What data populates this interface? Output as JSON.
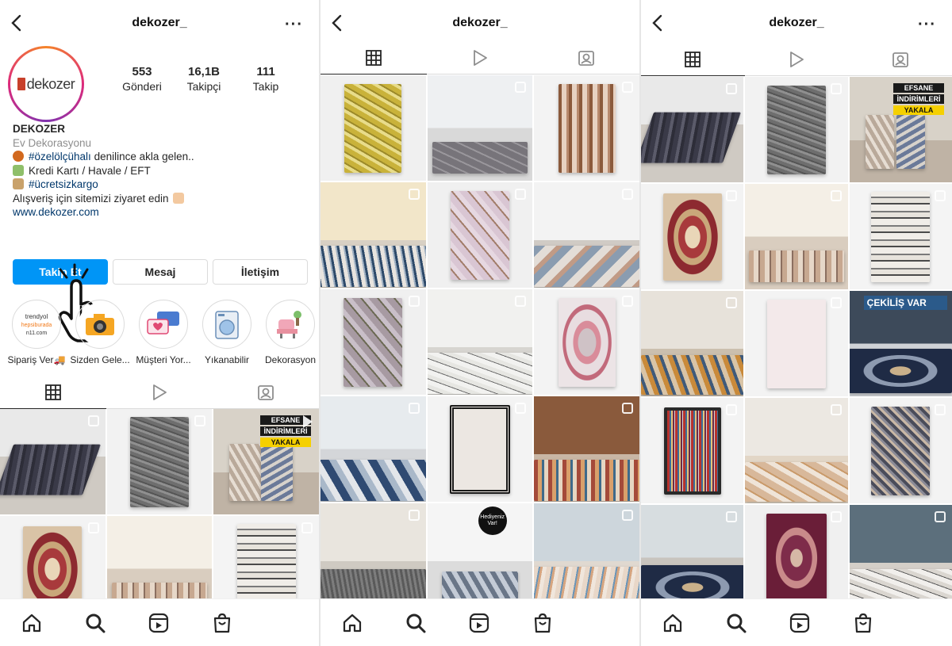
{
  "profile": {
    "username": "dekozer_",
    "logo_text": "dekozer",
    "posts_count": "553",
    "posts_label": "Gönderi",
    "followers_count": "16,1B",
    "followers_label": "Takipçi",
    "following_count": "111",
    "following_label": "Takip",
    "name": "DEKOZER",
    "category": "Ev Dekorasyonu",
    "bio_line1_tag": "#özelölçühalı",
    "bio_line1_text": " denilince akla gelen..",
    "bio_line2": "Kredi Kartı / Havale / EFT",
    "bio_line3_tag": "#ücretsizkargo",
    "bio_line4": "Alışveriş için sitemizi ziyaret edin",
    "website": "www.dekozer.com"
  },
  "buttons": {
    "follow": "Takip Et",
    "message": "Mesaj",
    "contact": "İletişim"
  },
  "highlights": [
    {
      "label": "Sipariş Ver🚚",
      "logo_a": "trendyol",
      "logo_b": "hepsiburada",
      "logo_c": "n11.com"
    },
    {
      "label": "Sizden Gele..."
    },
    {
      "label": "Müşteri Yor..."
    },
    {
      "label": "Yıkanabilir"
    },
    {
      "label": "Dekorasyon"
    }
  ],
  "promo": {
    "efsane": "EFSANE",
    "indirimleri": "İNDİRİMLERİ",
    "yakala": "YAKALA",
    "cekilis": "ÇEKİLİŞ VAR",
    "hediye": "Hediyeniz Var!"
  },
  "icons": {
    "back": "chevron-left-icon",
    "more": "more-horizontal-icon",
    "grid_tab": "grid-icon",
    "reels_tab": "play-icon",
    "tagged_tab": "tagged-user-icon",
    "nav_home": "home-icon",
    "nav_search": "search-icon",
    "nav_reels": "reels-icon",
    "nav_shop": "shop-bag-icon"
  },
  "colors": {
    "primary_button": "#0095f6",
    "link": "#00376b",
    "brand": "#c8402b"
  }
}
